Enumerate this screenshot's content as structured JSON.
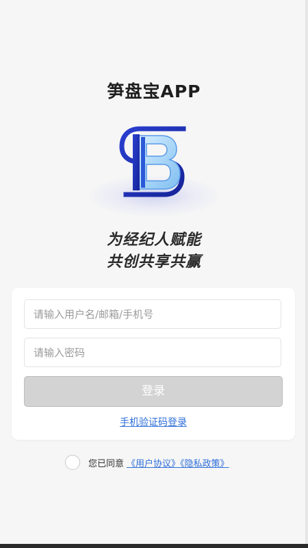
{
  "header": {
    "app_title": "笋盘宝APP"
  },
  "logo": {
    "icon": "sb-logo-icon",
    "colors": {
      "dark_blue": "#1c2fb5",
      "light_blue": "#9fd4f5",
      "mid_blue": "#4a86e0"
    }
  },
  "slogan": {
    "line1": "为经纪人赋能",
    "line2": "共创共享共赢"
  },
  "login_form": {
    "username_placeholder": "请输入用户名/邮箱/手机号",
    "password_placeholder": "请输入密码",
    "login_label": "登录",
    "sms_login_label": "手机验证码登录"
  },
  "agreement": {
    "prefix": "您已同意",
    "links": "《用户协议》《隐私政策》",
    "checked": false
  },
  "colors": {
    "link": "#2e6fd9",
    "button_disabled": "#d3d3d3",
    "background": "#f6f6f6"
  }
}
